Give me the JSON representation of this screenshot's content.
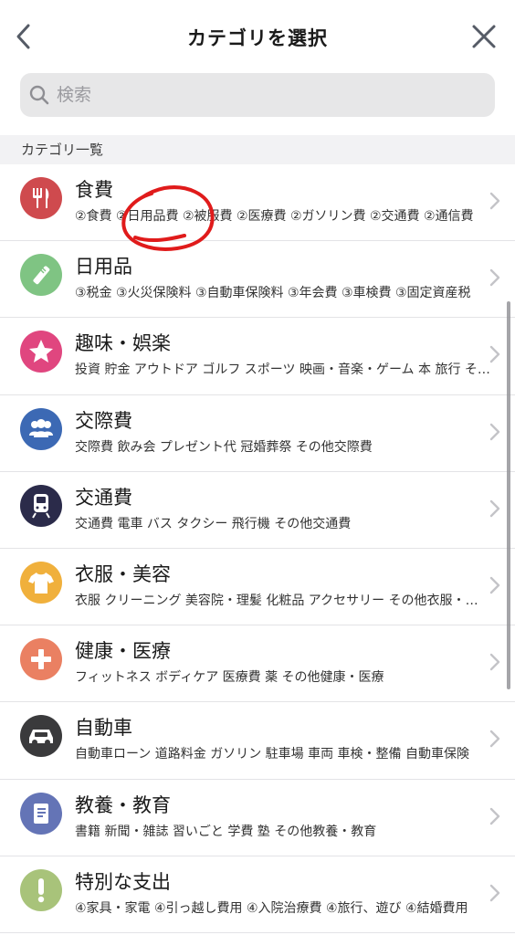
{
  "header": {
    "title": "カテゴリを選択",
    "back_icon": "chevron-left-icon",
    "close_icon": "close-icon"
  },
  "search": {
    "placeholder": "検索",
    "value": ""
  },
  "section": {
    "label": "カテゴリ一覧"
  },
  "categories": [
    {
      "title": "食費",
      "sub": "②食費 ②日用品費 ②被服費 ②医療費 ②ガソリン費 ②交通費 ②通信費",
      "icon": "fork-knife-icon",
      "color": "#cf4a4e"
    },
    {
      "title": "日用品",
      "sub": "③税金 ③火災保険料 ③自動車保険料 ③年会費 ③車検費 ③固定資産税",
      "icon": "toothbrush-icon",
      "color": "#7fc483"
    },
    {
      "title": "趣味・娯楽",
      "sub": "投資 貯金 アウトドア ゴルフ スポーツ 映画・音楽・ゲーム 本 旅行 その他",
      "icon": "star-icon",
      "color": "#e0467f"
    },
    {
      "title": "交際費",
      "sub": "交際費 飲み会 プレゼント代 冠婚葬祭 その他交際費",
      "icon": "people-icon",
      "color": "#3c69b4"
    },
    {
      "title": "交通費",
      "sub": "交通費 電車 バス タクシー 飛行機 その他交通費",
      "icon": "train-icon",
      "color": "#2b2b4a"
    },
    {
      "title": "衣服・美容",
      "sub": "衣服 クリーニング 美容院・理髪 化粧品 アクセサリー その他衣服・美容",
      "icon": "tshirt-icon",
      "color": "#f0b03c"
    },
    {
      "title": "健康・医療",
      "sub": "フィットネス ボディケア 医療費 薬 その他健康・医療",
      "icon": "plus-icon",
      "color": "#ea8062"
    },
    {
      "title": "自動車",
      "sub": "自動車ローン 道路料金 ガソリン 駐車場 車両 車検・整備 自動車保険",
      "icon": "car-icon",
      "color": "#3a3a3c"
    },
    {
      "title": "教養・教育",
      "sub": "書籍 新聞・雑誌 習いごと 学費 塾 その他教養・教育",
      "icon": "book-icon",
      "color": "#6474b6"
    },
    {
      "title": "特別な支出",
      "sub": "④家具・家電 ④引っ越し費用 ④入院治療費 ④旅行、遊び ④結婚費用",
      "icon": "exclamation-icon",
      "color": "#a8c37a"
    }
  ],
  "chevron_icon": "chevron-right-icon"
}
